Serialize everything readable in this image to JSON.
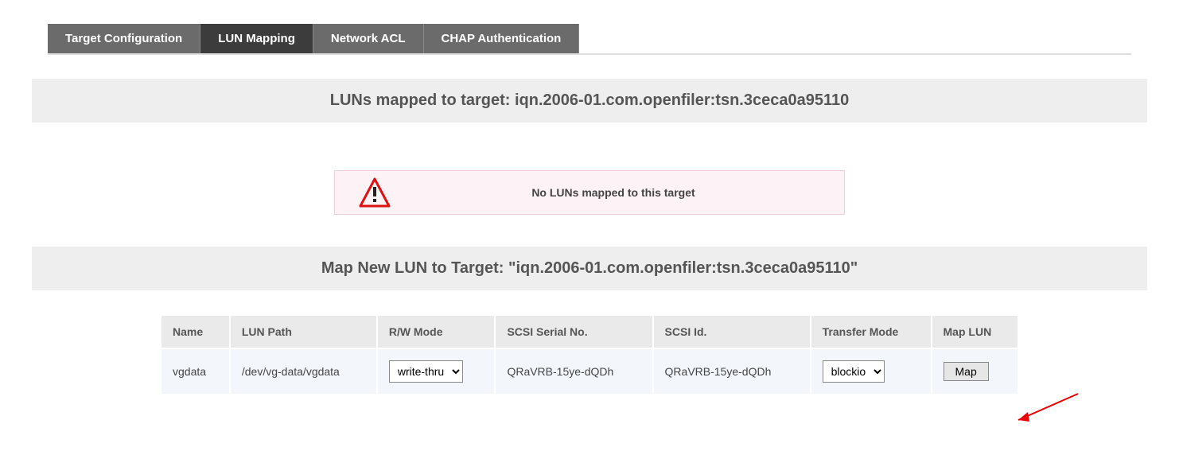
{
  "tabs": {
    "target_config": "Target Configuration",
    "lun_mapping": "LUN Mapping",
    "network_acl": "Network ACL",
    "chap_auth": "CHAP Authentication",
    "active": "lun_mapping"
  },
  "section1_title": "LUNs mapped to target: iqn.2006-01.com.openfiler:tsn.3ceca0a95110",
  "alert_msg": "No LUNs mapped to this target",
  "section2_title": "Map New LUN to Target: \"iqn.2006-01.com.openfiler:tsn.3ceca0a95110\"",
  "table": {
    "headers": {
      "name": "Name",
      "lun_path": "LUN Path",
      "rw_mode": "R/W Mode",
      "scsi_serial": "SCSI Serial No.",
      "scsi_id": "SCSI Id.",
      "transfer_mode": "Transfer Mode",
      "map_lun": "Map LUN"
    },
    "row": {
      "name": "vgdata",
      "lun_path": "/dev/vg-data/vgdata",
      "rw_mode_value": "write-thru",
      "scsi_serial": "QRaVRB-15ye-dQDh",
      "scsi_id": "QRaVRB-15ye-dQDh",
      "transfer_mode_value": "blockio",
      "map_btn": "Map"
    }
  }
}
